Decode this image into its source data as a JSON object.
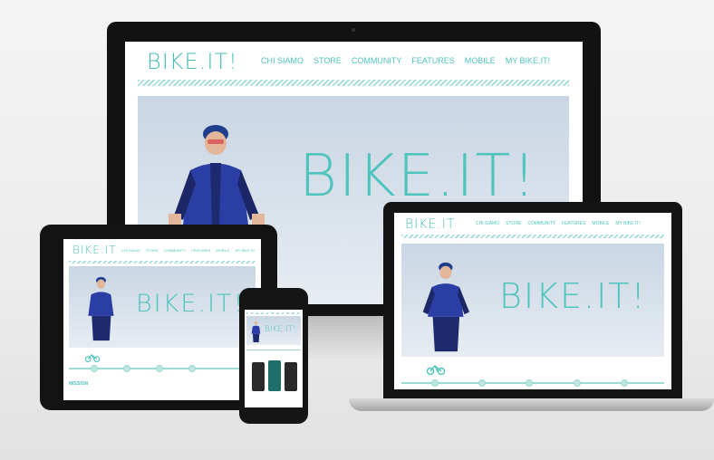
{
  "site": {
    "logo_main": "BIKE.IT!",
    "logo_small": "BIKE.IT",
    "hero_logo": "BIKE.IT!",
    "nav": [
      "CHI SIAMO",
      "STORE",
      "COMMUNITY",
      "FEATURES",
      "MOBILE",
      "MY BIKE.IT!"
    ]
  },
  "tablet": {
    "section_label": "MISSION"
  },
  "colors": {
    "accent": "#4fc3bd",
    "device_frame": "#141414",
    "hero_bg": "#d2dde8"
  },
  "icons": [
    "camera-icon",
    "bike-icon",
    "cyclist-image",
    "phone-app-screens"
  ]
}
